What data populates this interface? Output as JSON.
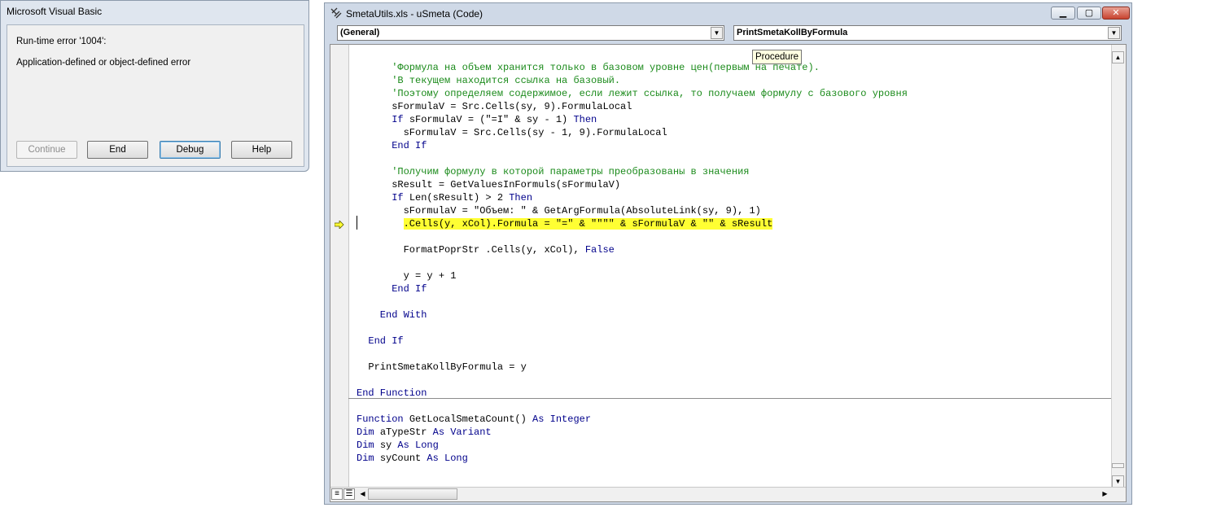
{
  "dialog": {
    "title": "Microsoft Visual Basic",
    "error_line": "Run-time error '1004':",
    "message": "Application-defined or object-defined error",
    "buttons": {
      "continue": "Continue",
      "end": "End",
      "debug": "Debug",
      "help": "Help"
    }
  },
  "code_window": {
    "title": "SmetaUtils.xls - uSmeta (Code)",
    "object_combo": "(General)",
    "procedure_combo": "PrintSmetaKollByFormula",
    "tooltip": "Procedure",
    "lines": [
      [
        {
          "t": "      'Формула на объем хранится только в базовом уровне цен(первым на печате).",
          "c": "c-cm"
        }
      ],
      [
        {
          "t": "      'В текущем находится ссылка на базовый.",
          "c": "c-cm"
        }
      ],
      [
        {
          "t": "      'Поэтому определяем содержимое, если лежит ссылка, то получаем формулу с базового уровня",
          "c": "c-cm"
        }
      ],
      [
        {
          "t": "      sFormulaV = Src.Cells(sy, 9).FormulaLocal",
          "c": "c-tx"
        }
      ],
      [
        {
          "t": "      If ",
          "c": "c-kw"
        },
        {
          "t": "sFormulaV = (\"=I\" & sy - 1) ",
          "c": "c-tx"
        },
        {
          "t": "Then",
          "c": "c-kw"
        }
      ],
      [
        {
          "t": "        sFormulaV = Src.Cells(sy - 1, 9).FormulaLocal",
          "c": "c-tx"
        }
      ],
      [
        {
          "t": "      End If",
          "c": "c-kw"
        }
      ],
      [
        {
          "t": "",
          "c": "c-tx"
        }
      ],
      [
        {
          "t": "      'Получим формулу в которой параметры преобразованы в значения",
          "c": "c-cm"
        }
      ],
      [
        {
          "t": "      sResult = GetValuesInFormuls(sFormulaV)",
          "c": "c-tx"
        }
      ],
      [
        {
          "t": "      If ",
          "c": "c-kw"
        },
        {
          "t": "Len(sResult) > 2 ",
          "c": "c-tx"
        },
        {
          "t": "Then",
          "c": "c-kw"
        }
      ],
      [
        {
          "t": "        sFormulaV = \"Объем: \" & GetArgFormula(AbsoluteLink(sy, 9), 1)",
          "c": "c-tx"
        }
      ],
      [
        {
          "t": "        ",
          "c": "c-tx"
        },
        {
          "t": ".Cells(y, xCol).Formula = \"=\" & \"\"\"\" & sFormulaV & \"\" & sResult",
          "c": "c-tx hl"
        }
      ],
      [
        {
          "t": "",
          "c": "c-tx"
        }
      ],
      [
        {
          "t": "        FormatPoprStr .Cells(y, xCol), ",
          "c": "c-tx"
        },
        {
          "t": "False",
          "c": "c-kw"
        }
      ],
      [
        {
          "t": "",
          "c": "c-tx"
        }
      ],
      [
        {
          "t": "        y = y + 1",
          "c": "c-tx"
        }
      ],
      [
        {
          "t": "      End If",
          "c": "c-kw"
        }
      ],
      [
        {
          "t": "",
          "c": "c-tx"
        }
      ],
      [
        {
          "t": "    End With",
          "c": "c-kw"
        }
      ],
      [
        {
          "t": "",
          "c": "c-tx"
        }
      ],
      [
        {
          "t": "  End If",
          "c": "c-kw"
        }
      ],
      [
        {
          "t": "",
          "c": "c-tx"
        }
      ],
      [
        {
          "t": "  PrintSmetaKollByFormula = y",
          "c": "c-tx"
        }
      ],
      [
        {
          "t": "",
          "c": "c-tx"
        }
      ],
      [
        {
          "t": "End Function",
          "c": "c-kw"
        }
      ],
      [
        {
          "t": "",
          "c": "c-tx"
        }
      ],
      [
        {
          "t": "Function ",
          "c": "c-kw"
        },
        {
          "t": "GetLocalSmetaCount() ",
          "c": "c-tx"
        },
        {
          "t": "As Integer",
          "c": "c-kw"
        }
      ],
      [
        {
          "t": "Dim ",
          "c": "c-kw"
        },
        {
          "t": "aTypeStr ",
          "c": "c-tx"
        },
        {
          "t": "As Variant",
          "c": "c-kw"
        }
      ],
      [
        {
          "t": "Dim ",
          "c": "c-kw"
        },
        {
          "t": "sy ",
          "c": "c-tx"
        },
        {
          "t": "As Long",
          "c": "c-kw"
        }
      ],
      [
        {
          "t": "Dim ",
          "c": "c-kw"
        },
        {
          "t": "syCount ",
          "c": "c-tx"
        },
        {
          "t": "As Long",
          "c": "c-kw"
        }
      ]
    ]
  },
  "colors": {
    "highlight": "#ffff33",
    "keyword": "#00008b",
    "comment": "#1a8a1a"
  },
  "icons": {
    "exec_arrow": "current-line-arrow-icon",
    "app": "vba-module-icon"
  }
}
